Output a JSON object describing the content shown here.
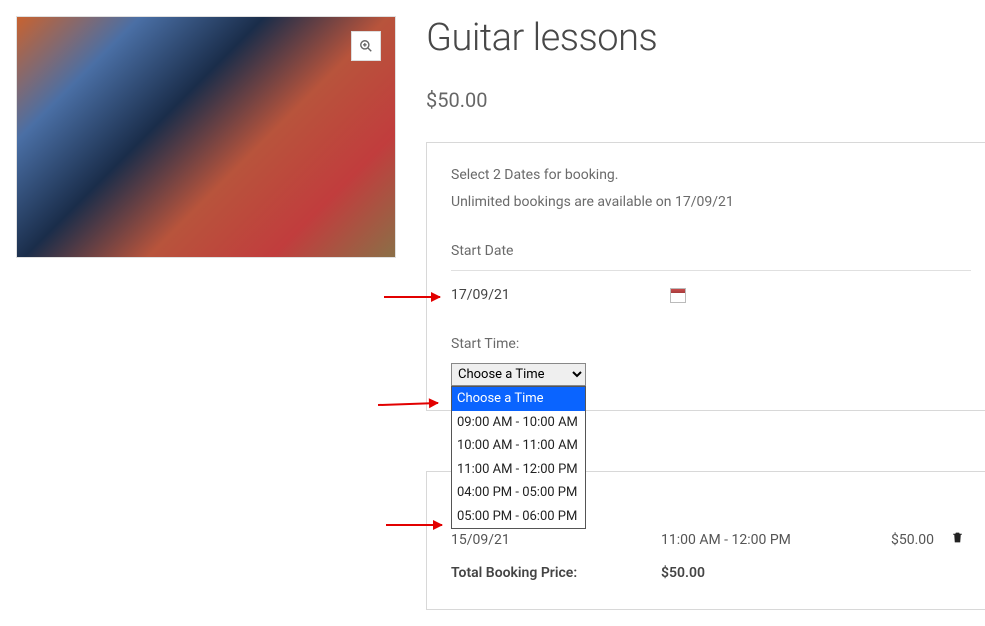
{
  "product": {
    "title": "Guitar lessons",
    "price": "$50.00"
  },
  "booking": {
    "instruction": "Select 2 Dates for booking.",
    "availability": "Unlimited bookings are available on 17/09/21",
    "start_date_label": "Start Date",
    "start_date_value": "17/09/21",
    "start_time_label": "Start Time:",
    "time_placeholder": "Choose a Time",
    "time_options": [
      "Choose a Time",
      "09:00 AM - 10:00 AM",
      "10:00 AM - 11:00 AM",
      "11:00 AM - 12:00 PM",
      "04:00 PM - 05:00 PM",
      "05:00 PM - 06:00 PM"
    ]
  },
  "summary": {
    "rows": [
      {
        "date": "15/09/21",
        "time": "11:00 AM - 12:00 PM",
        "price": "$50.00"
      }
    ],
    "total_label": "Total Booking Price:",
    "total_value": "$50.00"
  },
  "icons": {
    "zoom": "search-plus-icon",
    "calendar": "calendar-icon",
    "trash": "trash-icon"
  }
}
